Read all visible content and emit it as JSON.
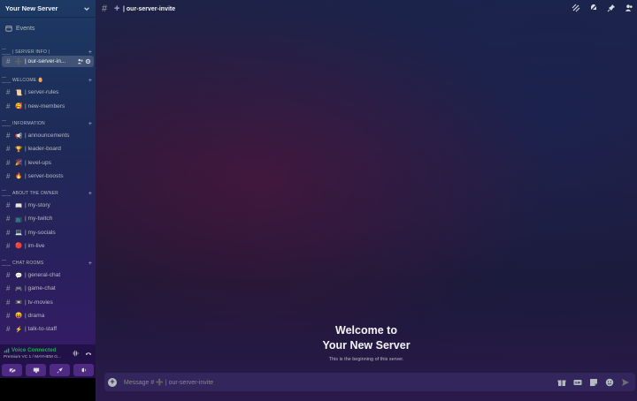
{
  "server": {
    "name": "Your New Server"
  },
  "events": {
    "label": "Events"
  },
  "categories": [
    {
      "label": "| SERVER INFO |",
      "channels": [
        {
          "emoji": "➕",
          "name": "| our-server-in...",
          "active": true
        }
      ]
    },
    {
      "label": "WELCOME 🥚",
      "channels": [
        {
          "emoji": "📜",
          "name": "| server-rules"
        },
        {
          "emoji": "🥰",
          "name": "| new-members"
        }
      ]
    },
    {
      "label": "INFORMATION",
      "channels": [
        {
          "emoji": "📢",
          "name": "| announcements"
        },
        {
          "emoji": "🏆",
          "name": "| leader-board"
        },
        {
          "emoji": "🎉",
          "name": "| level-ups"
        },
        {
          "emoji": "🔥",
          "name": "| server-boosts"
        }
      ]
    },
    {
      "label": "ABOUT THE OWNER",
      "channels": [
        {
          "emoji": "📖",
          "name": "| my-story"
        },
        {
          "emoji": "📺",
          "name": "| my-twitch"
        },
        {
          "emoji": "💻",
          "name": "| my-socials"
        },
        {
          "emoji": "🔴",
          "name": "| im-live"
        }
      ]
    },
    {
      "label": "CHAT ROOMS",
      "channels": [
        {
          "emoji": "💬",
          "name": "| general-chat"
        },
        {
          "emoji": "🎮",
          "name": "| game-chat"
        },
        {
          "emoji": "📼",
          "name": "| tv-movies"
        },
        {
          "emoji": "😝",
          "name": "| drama"
        },
        {
          "emoji": "⚡",
          "name": "| talk-to-staff"
        }
      ]
    }
  ],
  "voice": {
    "status": "Voice Connected",
    "channel": "Premium VC 1 / MAYHEM G..."
  },
  "header": {
    "channel_title": "| our-server-invite"
  },
  "welcome": {
    "line1": "Welcome to",
    "line2": "Your New Server",
    "subtitle": "This is the beginning of this server."
  },
  "composer": {
    "placeholder": "Message # ➕ | our-server-invite"
  },
  "colors": {
    "voice_green": "#23a55a",
    "accent_purple": "#b39ddb",
    "sidebar_top": "#1c3a64",
    "sidebar_bottom": "#3a1a6a"
  }
}
